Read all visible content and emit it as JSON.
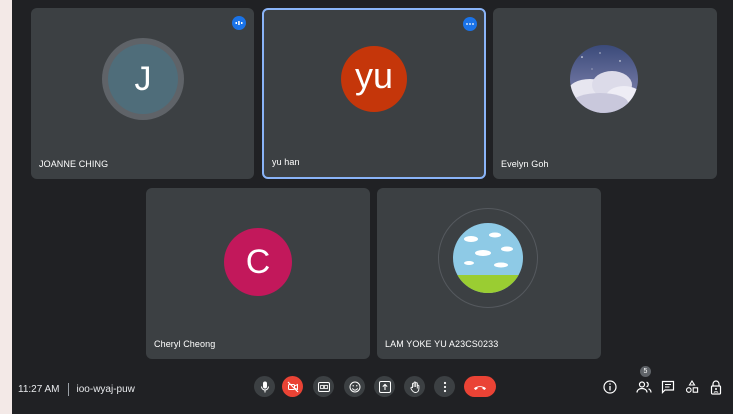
{
  "participants": [
    {
      "name": "JOANNE CHING",
      "initial": "J"
    },
    {
      "name": "yu han",
      "initial": "yu"
    },
    {
      "name": "Evelyn Goh"
    },
    {
      "name": "Cheryl Cheong",
      "initial": "C"
    },
    {
      "name": "LAM YOKE YU A23CS0233"
    }
  ],
  "meeting": {
    "time": "11:27 AM",
    "code": "ioo-wyaj-puw"
  },
  "people_count": "5",
  "colors": {
    "background": "#202124",
    "tile": "#3c4043",
    "active_border": "#8ab4f8",
    "end_call": "#ea4335",
    "yu_avatar": "#c5360a",
    "cheryl_avatar": "#c2185b",
    "joanne_avatar": "#4f6d7a"
  },
  "controls": [
    "mic-icon",
    "camera-off-icon",
    "captions-icon",
    "emoji-icon",
    "present-icon",
    "raise-hand-icon",
    "more-options-icon",
    "end-call-icon"
  ],
  "right_controls": [
    "info-icon",
    "people-icon",
    "chat-icon",
    "activities-icon",
    "host-controls-icon"
  ]
}
